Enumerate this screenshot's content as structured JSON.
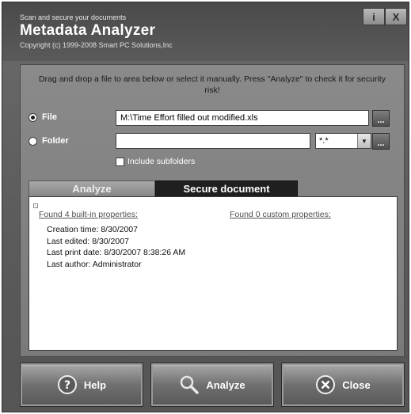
{
  "header": {
    "tagline": "Scan and secure your documents",
    "app_title": "Metadata Analyzer",
    "copyright": "Copyright (c) 1999-2008 Smart PC Solutions,Inc",
    "info_label": "i",
    "close_label": "X"
  },
  "instructions": "Drag and drop a file to area below or select it manually. Press \"Analyze\" to check it for security risk!",
  "source": {
    "file_label": "File",
    "file_value": "M:\\Time  Effort filled out modified.xls",
    "folder_label": "Folder",
    "folder_value": "",
    "mask_value": "*.*",
    "browse_label": "...",
    "include_subfolders_label": "Include subfolders"
  },
  "tabs": {
    "analyze": "Analyze",
    "secure": "Secure document"
  },
  "results": {
    "builtin_link": "Found 4 built-in properties:",
    "custom_link": "Found 0 custom properties:",
    "properties": [
      "Creation time: 8/30/2007",
      "Last edited: 8/30/2007",
      "Last print date: 8/30/2007 8:38:26 AM",
      "Last author: Administrator"
    ]
  },
  "buttons": {
    "help": "Help",
    "analyze": "Analyze",
    "close": "Close"
  }
}
